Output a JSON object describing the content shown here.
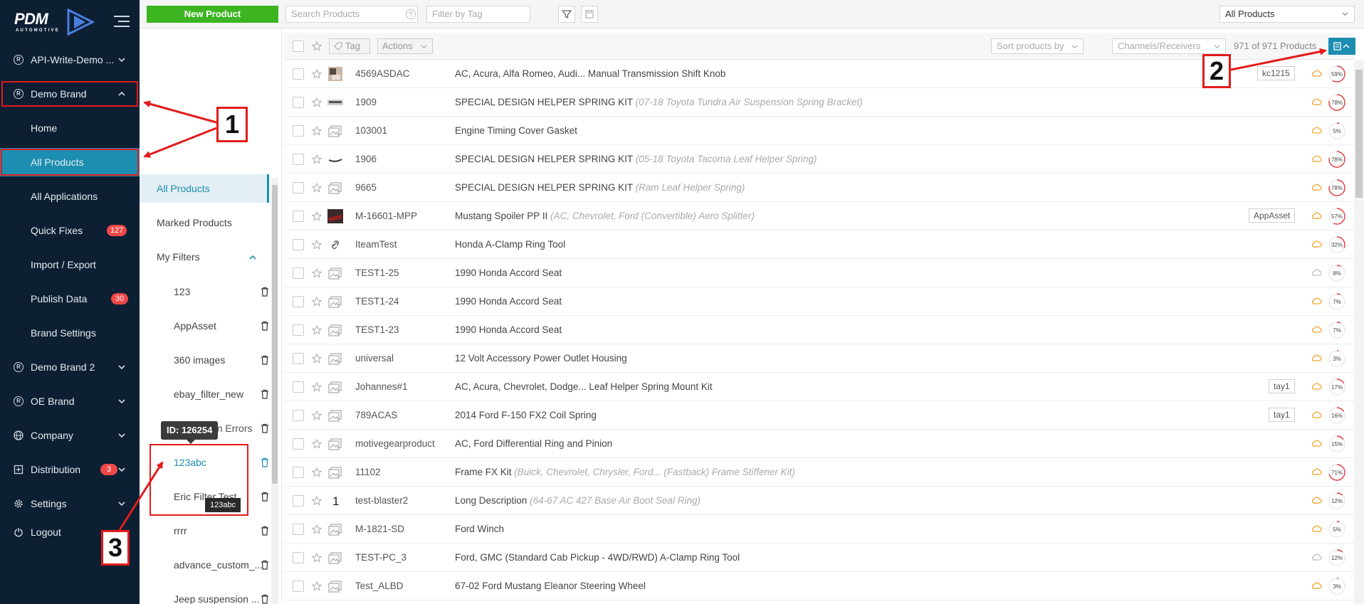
{
  "brand": {
    "logo_text": "PDM",
    "logo_sub": "AUTOMOTIVE"
  },
  "sidebar": {
    "items": [
      {
        "label": "API-Write-Demo ...",
        "icon": "registered-icon"
      },
      {
        "label": "Demo Brand",
        "icon": "registered-icon"
      },
      {
        "label": "Home"
      },
      {
        "label": "All Products"
      },
      {
        "label": "All Applications"
      },
      {
        "label": "Quick Fixes",
        "badge": "127"
      },
      {
        "label": "Import / Export"
      },
      {
        "label": "Publish Data",
        "badge": "30"
      },
      {
        "label": "Brand Settings"
      },
      {
        "label": "Demo Brand 2",
        "icon": "registered-icon"
      },
      {
        "label": "OE Brand",
        "icon": "registered-icon"
      },
      {
        "label": "Company",
        "icon": "globe-icon"
      },
      {
        "label": "Distribution",
        "icon": "distribution-icon",
        "badge": "3"
      },
      {
        "label": "Settings",
        "icon": "gear-icon"
      },
      {
        "label": "Logout",
        "icon": "logout-icon"
      }
    ]
  },
  "toolbar": {
    "new_product": "New Product",
    "search_placeholder": "Search Products",
    "tag_placeholder": "Filter by Tag",
    "view_select": "All Products"
  },
  "filters": {
    "all_products": "All Products",
    "marked_products": "Marked Products",
    "my_filters": "My Filters",
    "items": [
      "123",
      "AppAsset",
      "360 images",
      "ebay_filter_new",
      "Application Errors",
      "123abc",
      "Eric Filter Test",
      "rrrr",
      "advance_custom_...",
      "Jeep suspension ..."
    ],
    "tooltip_id": "ID: 126254",
    "tooltip_name": "123abc"
  },
  "list_toolbar": {
    "tag": "Tag",
    "actions": "Actions",
    "sort": "Sort products by",
    "channels": "Channels/Receivers",
    "count": "971 of 971 Products"
  },
  "products": [
    {
      "id": "4569ASDAC",
      "name": "AC, Acura, Alfa Romeo, Audi... Manual Transmission Shift Knob",
      "desc": "",
      "tag": "kc1215",
      "pct": 59,
      "thumb": "photo-knob"
    },
    {
      "id": "1909",
      "name": "SPECIAL DESIGN HELPER SPRING KIT",
      "desc": "(07-18 Toyota Tundra Air Suspension Spring Bracket)",
      "tag": "",
      "pct": 78,
      "thumb": "photo-bracket"
    },
    {
      "id": "103001",
      "name": "Engine Timing Cover Gasket",
      "desc": "",
      "tag": "",
      "pct": 5,
      "thumb": "image-placeholder"
    },
    {
      "id": "1906",
      "name": "SPECIAL DESIGN HELPER SPRING KIT",
      "desc": "(05-18 Toyota Tacoma Leaf Helper Spring)",
      "tag": "",
      "pct": 78,
      "thumb": "photo-spring"
    },
    {
      "id": "9665",
      "name": "SPECIAL DESIGN HELPER SPRING KIT",
      "desc": "(Ram Leaf Helper Spring)",
      "tag": "",
      "pct": 78,
      "thumb": "image-placeholder"
    },
    {
      "id": "M-16601-MPP",
      "name": "Mustang Spoiler PP II",
      "desc": "(AC, Chevrolet, Ford (Convertible) Aero Splitter)",
      "tag": "AppAsset",
      "pct": 57,
      "thumb": "photo-spoiler"
    },
    {
      "id": "IteamTest",
      "name": "Honda A-Clamp Ring Tool",
      "desc": "",
      "tag": "",
      "pct": 32,
      "thumb": "link"
    },
    {
      "id": "TEST1-25",
      "name": "1990 Honda Accord Seat",
      "desc": "",
      "tag": "",
      "pct": 8,
      "thumb": "image-placeholder"
    },
    {
      "id": "TEST1-24",
      "name": "1990 Honda Accord Seat",
      "desc": "",
      "tag": "",
      "pct": 7,
      "thumb": "image-placeholder"
    },
    {
      "id": "TEST1-23",
      "name": "1990 Honda Accord Seat",
      "desc": "",
      "tag": "",
      "pct": 7,
      "thumb": "image-placeholder"
    },
    {
      "id": "universal",
      "name": "12 Volt Accessory Power Outlet Housing",
      "desc": "",
      "tag": "",
      "pct": 3,
      "thumb": "image-placeholder"
    },
    {
      "id": "Johannes#1",
      "name": "AC, Acura, Chevrolet, Dodge... Leaf Helper Spring Mount Kit",
      "desc": "",
      "tag": "tay1",
      "pct": 17,
      "thumb": "image-placeholder"
    },
    {
      "id": "789ACAS",
      "name": "2014 Ford F-150 FX2 Coil Spring",
      "desc": "",
      "tag": "tay1",
      "pct": 16,
      "thumb": "image-placeholder"
    },
    {
      "id": "motivegearproduct",
      "name": "AC, Ford Differential Ring and Pinion",
      "desc": "",
      "tag": "",
      "pct": 15,
      "thumb": "image-placeholder"
    },
    {
      "id": "11102",
      "name": "Frame FX Kit",
      "desc": "(Buick, Chevrolet, Chrysler, Ford... (Fastback) Frame Stiffener Kit)",
      "tag": "",
      "pct": 71,
      "thumb": "image-placeholder"
    },
    {
      "id": "test-blaster2",
      "name": "Long Description",
      "desc": "(64-67 AC 427 Base Air Boot Seal Ring)",
      "tag": "",
      "pct": 12,
      "thumb": "digit-1"
    },
    {
      "id": "M-1821-SD",
      "name": "Ford Winch",
      "desc": "",
      "tag": "",
      "pct": 5,
      "thumb": "image-placeholder"
    },
    {
      "id": "TEST-PC_3",
      "name": "Ford, GMC (Standard Cab Pickup - 4WD/RWD) A-Clamp Ring Tool",
      "desc": "",
      "tag": "",
      "pct": 12,
      "thumb": "image-placeholder"
    },
    {
      "id": "Test_ALBD",
      "name": "67-02 Ford Mustang Eleanor Steering Wheel",
      "desc": "",
      "tag": "",
      "pct": 3,
      "thumb": "image-placeholder"
    }
  ],
  "annotations": {
    "one": "1",
    "two": "2",
    "three": "3"
  },
  "colors": {
    "sidebar": "#0c1f33",
    "accent": "#1c8eb0",
    "green": "#3cb521",
    "badge": "#f04848",
    "annotation": "#e31b1b",
    "cloud": "#f0a020"
  }
}
